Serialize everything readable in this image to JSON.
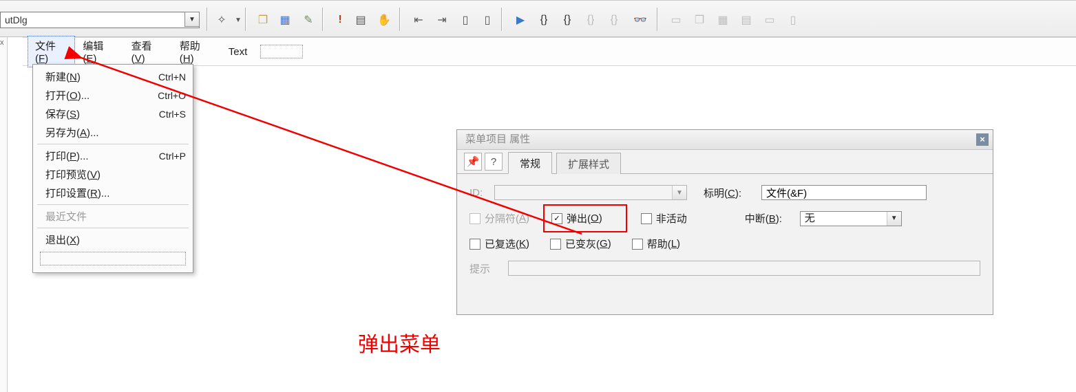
{
  "toolbar": {
    "combo_value": "utDlg",
    "icons": [
      "wizard",
      "stack",
      "grid",
      "brush",
      "divider",
      "exclaim",
      "list",
      "hand",
      "divider",
      "indent-left",
      "indent-right",
      "doc-stack",
      "divider",
      "play",
      "braces",
      "braces2",
      "braces-grey",
      "braces-grey2",
      "glasses",
      "divider",
      "window",
      "dup-window",
      "table",
      "form",
      "tool",
      "dialog"
    ]
  },
  "menu": {
    "items": [
      {
        "label": "文件",
        "accel": "F"
      },
      {
        "label": "编辑",
        "accel": "E"
      },
      {
        "label": "查看",
        "accel": "V"
      },
      {
        "label": "帮助",
        "accel": "H"
      },
      {
        "label": "Text",
        "accel": ""
      }
    ]
  },
  "dropdown": {
    "sections": [
      [
        {
          "label": "新建",
          "accel": "N",
          "shortcut": "Ctrl+N"
        },
        {
          "label": "打开",
          "accel": "O",
          "suffix": "...",
          "shortcut": "Ctrl+O"
        },
        {
          "label": "保存",
          "accel": "S",
          "shortcut": "Ctrl+S"
        },
        {
          "label": "另存为",
          "accel": "A",
          "suffix": "..."
        }
      ],
      [
        {
          "label": "打印",
          "accel": "P",
          "suffix": "...",
          "shortcut": "Ctrl+P"
        },
        {
          "label": "打印预览",
          "accel": "V"
        },
        {
          "label": "打印设置",
          "accel": "R",
          "suffix": "..."
        }
      ],
      [
        {
          "label": "最近文件",
          "disabled": true
        }
      ],
      [
        {
          "label": "退出",
          "accel": "X"
        }
      ]
    ]
  },
  "properties": {
    "title": "菜单项目 属性",
    "tabs": {
      "general": "常规",
      "extended": "扩展样式"
    },
    "id_label": "ID:",
    "id_value": "",
    "caption_label": "标明(C):",
    "caption_value": "文件(&F)",
    "sep_label": "分隔符(A)",
    "popup_label": "弹出(O)",
    "inactive_label": "非活动",
    "break_label": "中断(B):",
    "break_value": "无",
    "checked_label": "已复选(K)",
    "grayed_label": "已变灰(G)",
    "help_label": "帮助(L)",
    "prompt_label": "提示",
    "popup_checked": true
  },
  "annotation": {
    "text": "弹出菜单"
  }
}
